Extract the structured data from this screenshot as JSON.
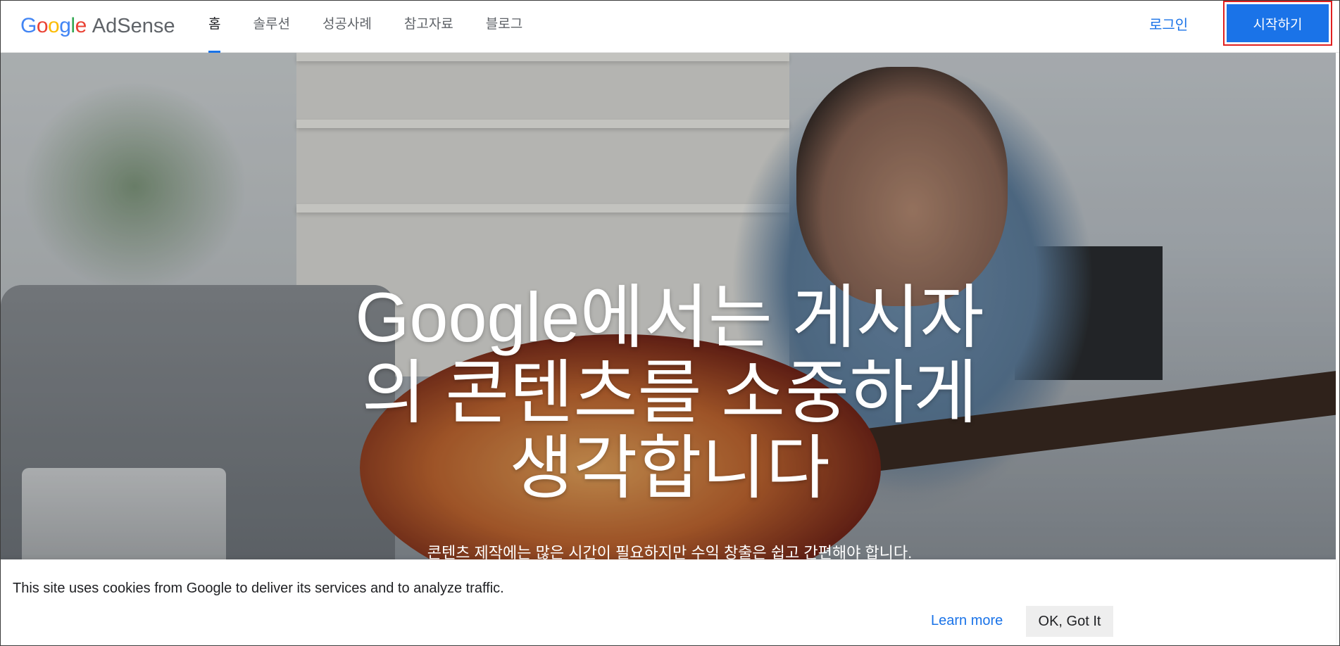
{
  "header": {
    "logo_google_letters": [
      "G",
      "o",
      "o",
      "g",
      "l",
      "e"
    ],
    "logo_product": "AdSense",
    "nav": [
      {
        "label": "홈",
        "active": true
      },
      {
        "label": "솔루션"
      },
      {
        "label": "성공사례"
      },
      {
        "label": "참고자료"
      },
      {
        "label": "블로그"
      }
    ],
    "login_label": "로그인",
    "start_label": "시작하기"
  },
  "hero": {
    "title_lines": [
      "Google에서는 게시자",
      "의 콘텐츠를 소중하게",
      "생각합니다"
    ],
    "subtitle": "콘텐츠 제작에는 많은 시간이 필요하지만 수익 창출은 쉽고 간편해야 합니다."
  },
  "cookie": {
    "message": "This site uses cookies from Google to deliver its services and to analyze traffic.",
    "learn_more": "Learn more",
    "ok": "OK, Got It"
  },
  "colors": {
    "accent": "#1a73e8",
    "highlight_border": "#e02020"
  }
}
